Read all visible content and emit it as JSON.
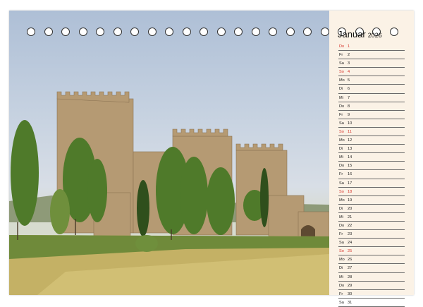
{
  "calendar": {
    "month": "Januar",
    "year": "2026",
    "accent_color": "#d6362d",
    "days": [
      {
        "wd": "Do",
        "d": "1",
        "hl": true
      },
      {
        "wd": "Fr",
        "d": "2",
        "hl": false
      },
      {
        "wd": "Sa",
        "d": "3",
        "hl": false
      },
      {
        "wd": "So",
        "d": "4",
        "hl": true
      },
      {
        "wd": "Mo",
        "d": "5",
        "hl": false
      },
      {
        "wd": "Di",
        "d": "6",
        "hl": false
      },
      {
        "wd": "Mi",
        "d": "7",
        "hl": false
      },
      {
        "wd": "Do",
        "d": "8",
        "hl": false
      },
      {
        "wd": "Fr",
        "d": "9",
        "hl": false
      },
      {
        "wd": "Sa",
        "d": "10",
        "hl": false
      },
      {
        "wd": "So",
        "d": "11",
        "hl": true
      },
      {
        "wd": "Mo",
        "d": "12",
        "hl": false
      },
      {
        "wd": "Di",
        "d": "13",
        "hl": false
      },
      {
        "wd": "Mi",
        "d": "14",
        "hl": false
      },
      {
        "wd": "Do",
        "d": "15",
        "hl": false
      },
      {
        "wd": "Fr",
        "d": "16",
        "hl": false
      },
      {
        "wd": "Sa",
        "d": "17",
        "hl": false
      },
      {
        "wd": "So",
        "d": "18",
        "hl": true
      },
      {
        "wd": "Mo",
        "d": "19",
        "hl": false
      },
      {
        "wd": "Di",
        "d": "20",
        "hl": false
      },
      {
        "wd": "Mi",
        "d": "21",
        "hl": false
      },
      {
        "wd": "Do",
        "d": "22",
        "hl": false
      },
      {
        "wd": "Fr",
        "d": "23",
        "hl": false
      },
      {
        "wd": "Sa",
        "d": "24",
        "hl": false
      },
      {
        "wd": "So",
        "d": "25",
        "hl": true
      },
      {
        "wd": "Mo",
        "d": "26",
        "hl": false
      },
      {
        "wd": "Di",
        "d": "27",
        "hl": false
      },
      {
        "wd": "Mi",
        "d": "28",
        "hl": false
      },
      {
        "wd": "Do",
        "d": "29",
        "hl": false
      },
      {
        "wd": "Fr",
        "d": "30",
        "hl": false
      },
      {
        "wd": "Sa",
        "d": "31",
        "hl": false
      }
    ]
  },
  "binding_ring_count": 22
}
